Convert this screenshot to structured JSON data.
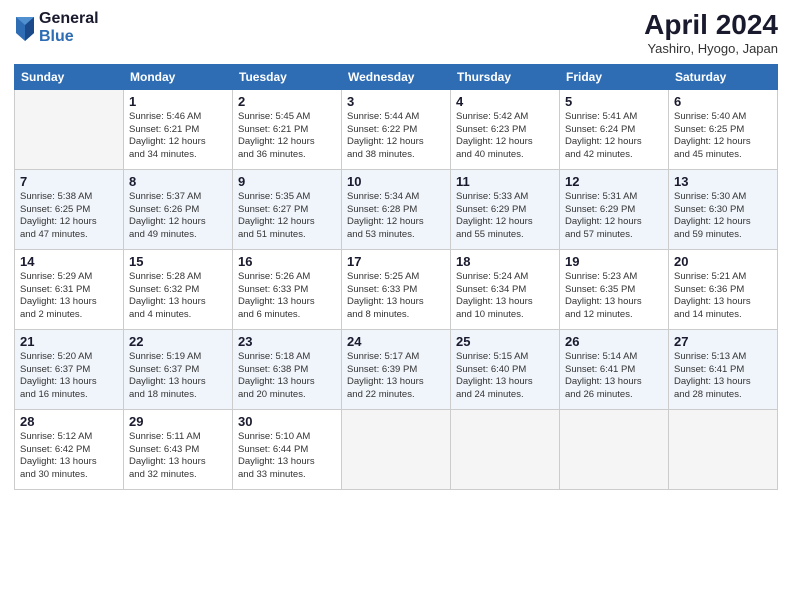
{
  "logo": {
    "general": "General",
    "blue": "Blue"
  },
  "title": "April 2024",
  "location": "Yashiro, Hyogo, Japan",
  "days_header": [
    "Sunday",
    "Monday",
    "Tuesday",
    "Wednesday",
    "Thursday",
    "Friday",
    "Saturday"
  ],
  "weeks": [
    [
      {
        "day": "",
        "info": ""
      },
      {
        "day": "1",
        "info": "Sunrise: 5:46 AM\nSunset: 6:21 PM\nDaylight: 12 hours\nand 34 minutes."
      },
      {
        "day": "2",
        "info": "Sunrise: 5:45 AM\nSunset: 6:21 PM\nDaylight: 12 hours\nand 36 minutes."
      },
      {
        "day": "3",
        "info": "Sunrise: 5:44 AM\nSunset: 6:22 PM\nDaylight: 12 hours\nand 38 minutes."
      },
      {
        "day": "4",
        "info": "Sunrise: 5:42 AM\nSunset: 6:23 PM\nDaylight: 12 hours\nand 40 minutes."
      },
      {
        "day": "5",
        "info": "Sunrise: 5:41 AM\nSunset: 6:24 PM\nDaylight: 12 hours\nand 42 minutes."
      },
      {
        "day": "6",
        "info": "Sunrise: 5:40 AM\nSunset: 6:25 PM\nDaylight: 12 hours\nand 45 minutes."
      }
    ],
    [
      {
        "day": "7",
        "info": "Sunrise: 5:38 AM\nSunset: 6:25 PM\nDaylight: 12 hours\nand 47 minutes."
      },
      {
        "day": "8",
        "info": "Sunrise: 5:37 AM\nSunset: 6:26 PM\nDaylight: 12 hours\nand 49 minutes."
      },
      {
        "day": "9",
        "info": "Sunrise: 5:35 AM\nSunset: 6:27 PM\nDaylight: 12 hours\nand 51 minutes."
      },
      {
        "day": "10",
        "info": "Sunrise: 5:34 AM\nSunset: 6:28 PM\nDaylight: 12 hours\nand 53 minutes."
      },
      {
        "day": "11",
        "info": "Sunrise: 5:33 AM\nSunset: 6:29 PM\nDaylight: 12 hours\nand 55 minutes."
      },
      {
        "day": "12",
        "info": "Sunrise: 5:31 AM\nSunset: 6:29 PM\nDaylight: 12 hours\nand 57 minutes."
      },
      {
        "day": "13",
        "info": "Sunrise: 5:30 AM\nSunset: 6:30 PM\nDaylight: 12 hours\nand 59 minutes."
      }
    ],
    [
      {
        "day": "14",
        "info": "Sunrise: 5:29 AM\nSunset: 6:31 PM\nDaylight: 13 hours\nand 2 minutes."
      },
      {
        "day": "15",
        "info": "Sunrise: 5:28 AM\nSunset: 6:32 PM\nDaylight: 13 hours\nand 4 minutes."
      },
      {
        "day": "16",
        "info": "Sunrise: 5:26 AM\nSunset: 6:33 PM\nDaylight: 13 hours\nand 6 minutes."
      },
      {
        "day": "17",
        "info": "Sunrise: 5:25 AM\nSunset: 6:33 PM\nDaylight: 13 hours\nand 8 minutes."
      },
      {
        "day": "18",
        "info": "Sunrise: 5:24 AM\nSunset: 6:34 PM\nDaylight: 13 hours\nand 10 minutes."
      },
      {
        "day": "19",
        "info": "Sunrise: 5:23 AM\nSunset: 6:35 PM\nDaylight: 13 hours\nand 12 minutes."
      },
      {
        "day": "20",
        "info": "Sunrise: 5:21 AM\nSunset: 6:36 PM\nDaylight: 13 hours\nand 14 minutes."
      }
    ],
    [
      {
        "day": "21",
        "info": "Sunrise: 5:20 AM\nSunset: 6:37 PM\nDaylight: 13 hours\nand 16 minutes."
      },
      {
        "day": "22",
        "info": "Sunrise: 5:19 AM\nSunset: 6:37 PM\nDaylight: 13 hours\nand 18 minutes."
      },
      {
        "day": "23",
        "info": "Sunrise: 5:18 AM\nSunset: 6:38 PM\nDaylight: 13 hours\nand 20 minutes."
      },
      {
        "day": "24",
        "info": "Sunrise: 5:17 AM\nSunset: 6:39 PM\nDaylight: 13 hours\nand 22 minutes."
      },
      {
        "day": "25",
        "info": "Sunrise: 5:15 AM\nSunset: 6:40 PM\nDaylight: 13 hours\nand 24 minutes."
      },
      {
        "day": "26",
        "info": "Sunrise: 5:14 AM\nSunset: 6:41 PM\nDaylight: 13 hours\nand 26 minutes."
      },
      {
        "day": "27",
        "info": "Sunrise: 5:13 AM\nSunset: 6:41 PM\nDaylight: 13 hours\nand 28 minutes."
      }
    ],
    [
      {
        "day": "28",
        "info": "Sunrise: 5:12 AM\nSunset: 6:42 PM\nDaylight: 13 hours\nand 30 minutes."
      },
      {
        "day": "29",
        "info": "Sunrise: 5:11 AM\nSunset: 6:43 PM\nDaylight: 13 hours\nand 32 minutes."
      },
      {
        "day": "30",
        "info": "Sunrise: 5:10 AM\nSunset: 6:44 PM\nDaylight: 13 hours\nand 33 minutes."
      },
      {
        "day": "",
        "info": ""
      },
      {
        "day": "",
        "info": ""
      },
      {
        "day": "",
        "info": ""
      },
      {
        "day": "",
        "info": ""
      }
    ]
  ]
}
